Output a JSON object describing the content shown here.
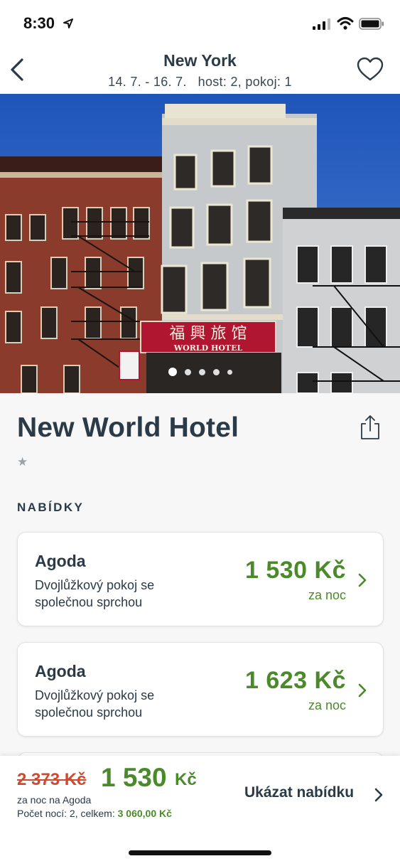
{
  "status_bar": {
    "time": "8:30",
    "icons": [
      "location-arrow-icon",
      "signal-icon",
      "wifi-icon",
      "battery-icon"
    ]
  },
  "header": {
    "title": "New York",
    "subtitle": "14. 7. - 16. 7.   host: 2, pokoj: 1",
    "back_icon": "chevron-left-icon",
    "favorite_icon": "heart-icon"
  },
  "gallery": {
    "photo_count": 5,
    "active_index": 0,
    "sign_text": "WORLD HOTEL"
  },
  "hotel": {
    "name": "New World Hotel",
    "stars": 1,
    "star_glyph": "★",
    "share_icon": "share-icon"
  },
  "offers_section": {
    "title": "NABÍDKY",
    "items": [
      {
        "provider": "Agoda",
        "room": "Dvojlůžkový pokoj se společnou sprchou",
        "price": "1 530 Kč",
        "per_night": "za noc"
      },
      {
        "provider": "Agoda",
        "room": "Dvojlůžkový pokoj se společnou sprchou",
        "price": "1 623 Kč",
        "per_night": "za noc"
      }
    ]
  },
  "bottom_bar": {
    "old_price": "2 373 Kč",
    "new_price": "1 530",
    "currency": "Kč",
    "per_night_note": "za noc na Agoda",
    "nights_label": "Počet nocí: 2, celkem: ",
    "nights_total": "3 060,00 Kč",
    "cta_label": "Ukázat nabídku"
  },
  "colors": {
    "price_green": "#4a8a2a",
    "old_price_red": "#d1492e",
    "text_dark": "#2a3a47"
  }
}
